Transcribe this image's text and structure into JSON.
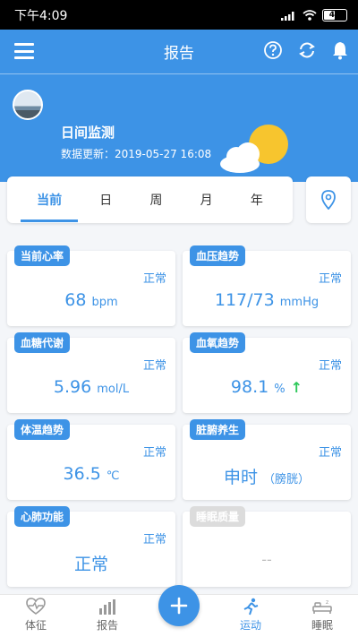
{
  "status_bar": {
    "time": "下午4:09",
    "battery": "45"
  },
  "appbar": {
    "title": "报告"
  },
  "monitor": {
    "title": "日间监测",
    "update_text": "数据更新：2019-05-27 16:08"
  },
  "tabs": [
    {
      "label": "当前",
      "active": true
    },
    {
      "label": "日",
      "active": false
    },
    {
      "label": "周",
      "active": false
    },
    {
      "label": "月",
      "active": false
    },
    {
      "label": "年",
      "active": false
    }
  ],
  "metrics": [
    {
      "label": "当前心率",
      "status": "正常",
      "value": "68",
      "unit": "bpm"
    },
    {
      "label": "血压趋势",
      "status": "正常",
      "value": "117/73",
      "unit": "mmHg"
    },
    {
      "label": "血糖代谢",
      "status": "正常",
      "value": "5.96",
      "unit": "mol/L"
    },
    {
      "label": "血氧趋势",
      "status": "正常",
      "value": "98.1",
      "unit": "%"
    },
    {
      "label": "体温趋势",
      "status": "正常",
      "value": "36.5",
      "unit": "℃"
    },
    {
      "label": "脏腑养生",
      "status": "正常",
      "value": "申时",
      "unit": "（膀胱）"
    },
    {
      "label": "心肺功能",
      "status": "正常",
      "value": "正常",
      "unit": ""
    },
    {
      "label": "睡眠质量",
      "status": "",
      "value": "--",
      "unit": ""
    }
  ],
  "bottom_nav": [
    {
      "label": "体征",
      "icon": "heartbeat-icon",
      "active": false
    },
    {
      "label": "报告",
      "icon": "bar-chart-icon",
      "active": false
    },
    {
      "label": "运动",
      "icon": "running-icon",
      "active": true
    },
    {
      "label": "睡眠",
      "icon": "bed-icon",
      "active": false
    }
  ],
  "colors": {
    "primary": "#3d93e6",
    "active_green": "#2ec85a",
    "disabled": "#dcdcdc"
  }
}
